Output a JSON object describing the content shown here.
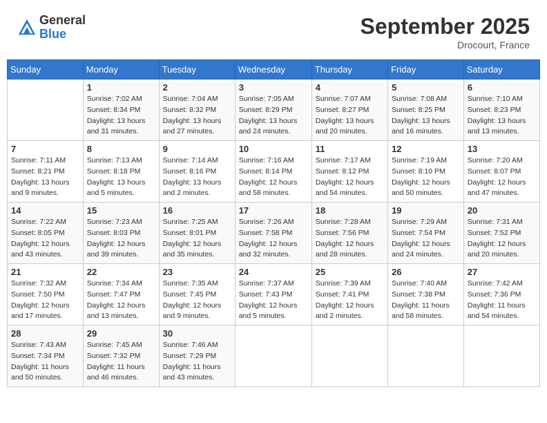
{
  "header": {
    "logo_general": "General",
    "logo_blue": "Blue",
    "month_title": "September 2025",
    "location": "Drocourt, France"
  },
  "calendar": {
    "days_of_week": [
      "Sunday",
      "Monday",
      "Tuesday",
      "Wednesday",
      "Thursday",
      "Friday",
      "Saturday"
    ],
    "weeks": [
      [
        {
          "day": "",
          "info": ""
        },
        {
          "day": "1",
          "info": "Sunrise: 7:02 AM\nSunset: 8:34 PM\nDaylight: 13 hours and 31 minutes."
        },
        {
          "day": "2",
          "info": "Sunrise: 7:04 AM\nSunset: 8:32 PM\nDaylight: 13 hours and 27 minutes."
        },
        {
          "day": "3",
          "info": "Sunrise: 7:05 AM\nSunset: 8:29 PM\nDaylight: 13 hours and 24 minutes."
        },
        {
          "day": "4",
          "info": "Sunrise: 7:07 AM\nSunset: 8:27 PM\nDaylight: 13 hours and 20 minutes."
        },
        {
          "day": "5",
          "info": "Sunrise: 7:08 AM\nSunset: 8:25 PM\nDaylight: 13 hours and 16 minutes."
        },
        {
          "day": "6",
          "info": "Sunrise: 7:10 AM\nSunset: 8:23 PM\nDaylight: 13 hours and 13 minutes."
        }
      ],
      [
        {
          "day": "7",
          "info": "Sunrise: 7:11 AM\nSunset: 8:21 PM\nDaylight: 13 hours and 9 minutes."
        },
        {
          "day": "8",
          "info": "Sunrise: 7:13 AM\nSunset: 8:18 PM\nDaylight: 13 hours and 5 minutes."
        },
        {
          "day": "9",
          "info": "Sunrise: 7:14 AM\nSunset: 8:16 PM\nDaylight: 13 hours and 2 minutes."
        },
        {
          "day": "10",
          "info": "Sunrise: 7:16 AM\nSunset: 8:14 PM\nDaylight: 12 hours and 58 minutes."
        },
        {
          "day": "11",
          "info": "Sunrise: 7:17 AM\nSunset: 8:12 PM\nDaylight: 12 hours and 54 minutes."
        },
        {
          "day": "12",
          "info": "Sunrise: 7:19 AM\nSunset: 8:10 PM\nDaylight: 12 hours and 50 minutes."
        },
        {
          "day": "13",
          "info": "Sunrise: 7:20 AM\nSunset: 8:07 PM\nDaylight: 12 hours and 47 minutes."
        }
      ],
      [
        {
          "day": "14",
          "info": "Sunrise: 7:22 AM\nSunset: 8:05 PM\nDaylight: 12 hours and 43 minutes."
        },
        {
          "day": "15",
          "info": "Sunrise: 7:23 AM\nSunset: 8:03 PM\nDaylight: 12 hours and 39 minutes."
        },
        {
          "day": "16",
          "info": "Sunrise: 7:25 AM\nSunset: 8:01 PM\nDaylight: 12 hours and 35 minutes."
        },
        {
          "day": "17",
          "info": "Sunrise: 7:26 AM\nSunset: 7:58 PM\nDaylight: 12 hours and 32 minutes."
        },
        {
          "day": "18",
          "info": "Sunrise: 7:28 AM\nSunset: 7:56 PM\nDaylight: 12 hours and 28 minutes."
        },
        {
          "day": "19",
          "info": "Sunrise: 7:29 AM\nSunset: 7:54 PM\nDaylight: 12 hours and 24 minutes."
        },
        {
          "day": "20",
          "info": "Sunrise: 7:31 AM\nSunset: 7:52 PM\nDaylight: 12 hours and 20 minutes."
        }
      ],
      [
        {
          "day": "21",
          "info": "Sunrise: 7:32 AM\nSunset: 7:50 PM\nDaylight: 12 hours and 17 minutes."
        },
        {
          "day": "22",
          "info": "Sunrise: 7:34 AM\nSunset: 7:47 PM\nDaylight: 12 hours and 13 minutes."
        },
        {
          "day": "23",
          "info": "Sunrise: 7:35 AM\nSunset: 7:45 PM\nDaylight: 12 hours and 9 minutes."
        },
        {
          "day": "24",
          "info": "Sunrise: 7:37 AM\nSunset: 7:43 PM\nDaylight: 12 hours and 5 minutes."
        },
        {
          "day": "25",
          "info": "Sunrise: 7:39 AM\nSunset: 7:41 PM\nDaylight: 12 hours and 2 minutes."
        },
        {
          "day": "26",
          "info": "Sunrise: 7:40 AM\nSunset: 7:38 PM\nDaylight: 11 hours and 58 minutes."
        },
        {
          "day": "27",
          "info": "Sunrise: 7:42 AM\nSunset: 7:36 PM\nDaylight: 11 hours and 54 minutes."
        }
      ],
      [
        {
          "day": "28",
          "info": "Sunrise: 7:43 AM\nSunset: 7:34 PM\nDaylight: 11 hours and 50 minutes."
        },
        {
          "day": "29",
          "info": "Sunrise: 7:45 AM\nSunset: 7:32 PM\nDaylight: 11 hours and 46 minutes."
        },
        {
          "day": "30",
          "info": "Sunrise: 7:46 AM\nSunset: 7:29 PM\nDaylight: 11 hours and 43 minutes."
        },
        {
          "day": "",
          "info": ""
        },
        {
          "day": "",
          "info": ""
        },
        {
          "day": "",
          "info": ""
        },
        {
          "day": "",
          "info": ""
        }
      ]
    ]
  }
}
